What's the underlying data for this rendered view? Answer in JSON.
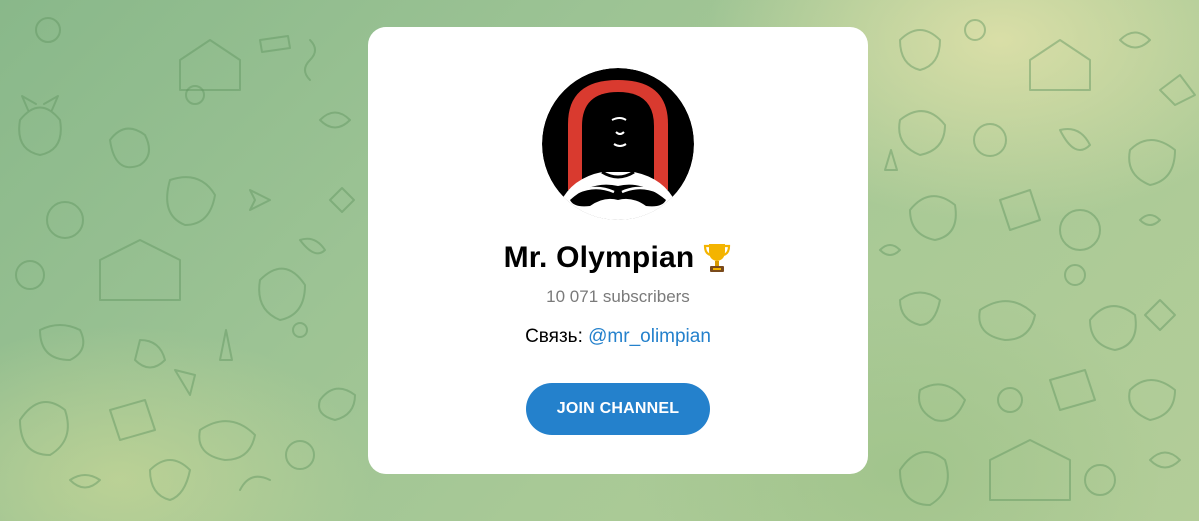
{
  "channel": {
    "title": "Mr. Olympian",
    "title_emoji": "trophy-icon",
    "subscribers": "10 071 subscribers",
    "description_prefix": "Связь: ",
    "description_link": "@mr_olimpian",
    "join_label": "JOIN CHANNEL"
  },
  "colors": {
    "accent": "#2481cc",
    "card_background": "#ffffff",
    "subscribers_text": "#7a7a7a",
    "avatar_red": "#d93a2f"
  },
  "icons": {
    "avatar": "bodybuilder-logo",
    "background_pattern": "cat-doodles-pattern"
  }
}
